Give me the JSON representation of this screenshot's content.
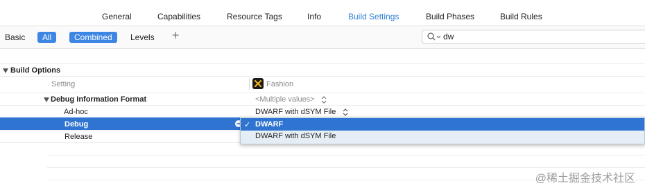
{
  "tabs": [
    {
      "label": "General",
      "active": false
    },
    {
      "label": "Capabilities",
      "active": false
    },
    {
      "label": "Resource Tags",
      "active": false
    },
    {
      "label": "Info",
      "active": false
    },
    {
      "label": "Build Settings",
      "active": true
    },
    {
      "label": "Build Phases",
      "active": false
    },
    {
      "label": "Build Rules",
      "active": false
    }
  ],
  "filters": {
    "basic_label": "Basic",
    "all_label": "All",
    "combined_label": "Combined",
    "levels_label": "Levels",
    "add_symbol": "+"
  },
  "search": {
    "value": "dw"
  },
  "section": {
    "title": "Build Options"
  },
  "columns": {
    "setting": "Setting",
    "target": "Fashion",
    "target_icon": "fashion-app-icon"
  },
  "setting": {
    "name": "Debug Information Format",
    "value": "<Multiple values>",
    "rows": [
      {
        "name": "Ad-hoc",
        "value": "DWARF with dSYM File"
      },
      {
        "name": "Debug",
        "value": "DWARF"
      },
      {
        "name": "Release",
        "value": ""
      }
    ]
  },
  "popup": {
    "items": [
      {
        "label": "DWARF",
        "checked": true,
        "check_mark": "✓"
      },
      {
        "label": "DWARF with dSYM File",
        "checked": false
      }
    ]
  },
  "watermark": "@稀土掘金技术社区",
  "colors": {
    "accent": "#2f74d0",
    "active_tab": "#2f7fd6",
    "pill": "#3d86e3"
  }
}
